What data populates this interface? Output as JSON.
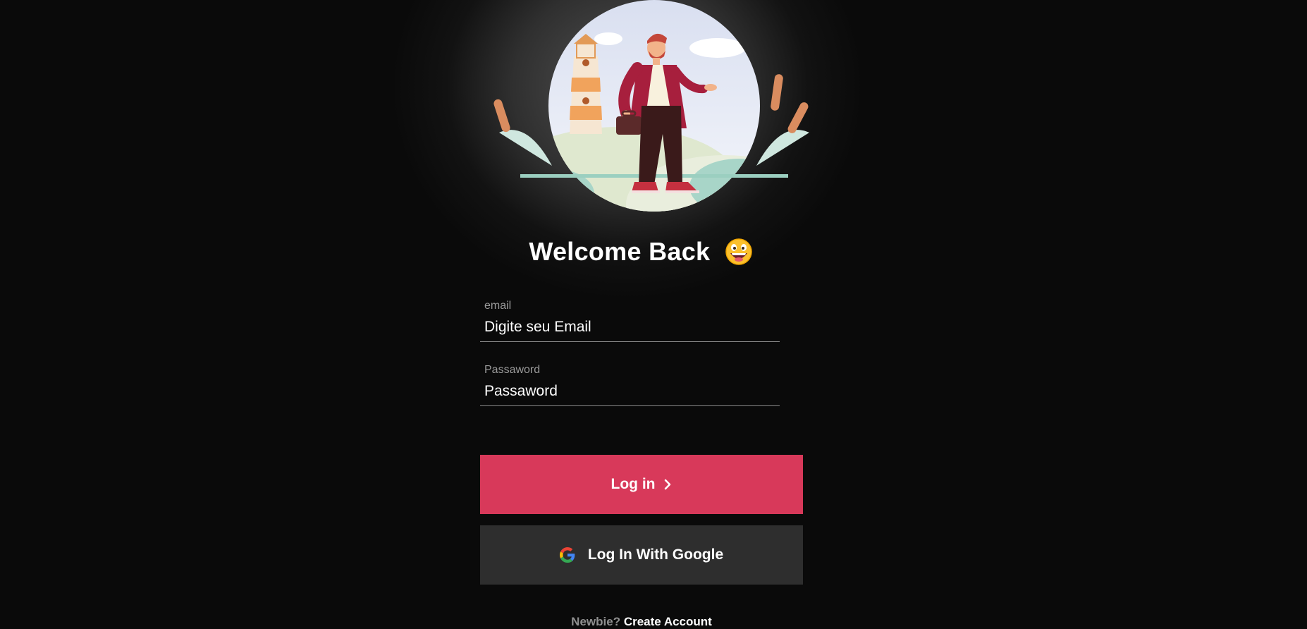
{
  "hero": {
    "title": "Welcome Back"
  },
  "form": {
    "email": {
      "label": "email",
      "placeholder": "Digite seu Email"
    },
    "password": {
      "label": "Passaword",
      "placeholder": "Passaword"
    }
  },
  "buttons": {
    "login": "Log in",
    "google": "Log In With Google"
  },
  "footer": {
    "prompt": "Newbie?",
    "link": "Create Account"
  },
  "colors": {
    "accent": "#d8395a",
    "background": "#0a0a0a",
    "secondary_button": "#2e2e2e"
  },
  "icons": [
    "person-illustration",
    "grinning-emoji",
    "chevron-right-icon",
    "google-icon"
  ]
}
